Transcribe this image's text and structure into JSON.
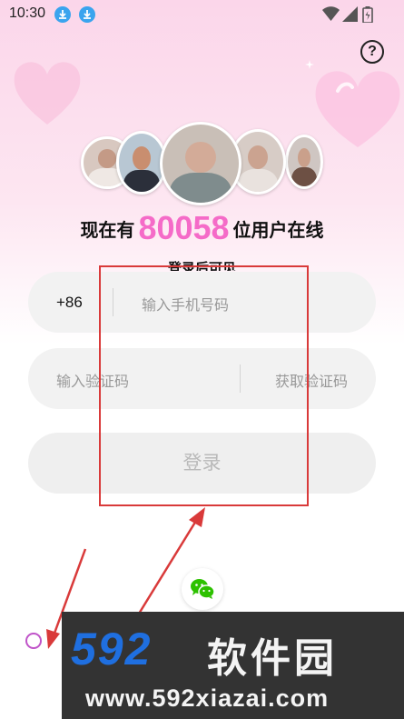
{
  "status_bar": {
    "time": "10:30",
    "icons": [
      "download-icon",
      "download-icon",
      "wifi-icon",
      "signal-icon",
      "battery-icon"
    ]
  },
  "help": {
    "icon": "question-icon",
    "glyph": "?"
  },
  "online": {
    "prefix": "现在有",
    "count": "80058",
    "suffix": "位用户在线",
    "count_color": "#f56bc8"
  },
  "subtitle": "登录后可见",
  "phone_field": {
    "country_code": "+86",
    "placeholder": "输入手机号码"
  },
  "code_field": {
    "placeholder": "输入验证码",
    "get_code_label": "获取验证码"
  },
  "login_button": {
    "label": "登录"
  },
  "wechat_login": {
    "icon": "wechat-icon"
  },
  "agreement": {
    "icon": "radio-unchecked-icon"
  },
  "watermark": {
    "brand": "592",
    "name": "软件园",
    "url": "www.592xiazai.com"
  },
  "colors": {
    "accent": "#f56bc8",
    "annotation": "#d93a3a",
    "wechat": "#2dc100",
    "watermark_brand": "#1f6fe0"
  }
}
